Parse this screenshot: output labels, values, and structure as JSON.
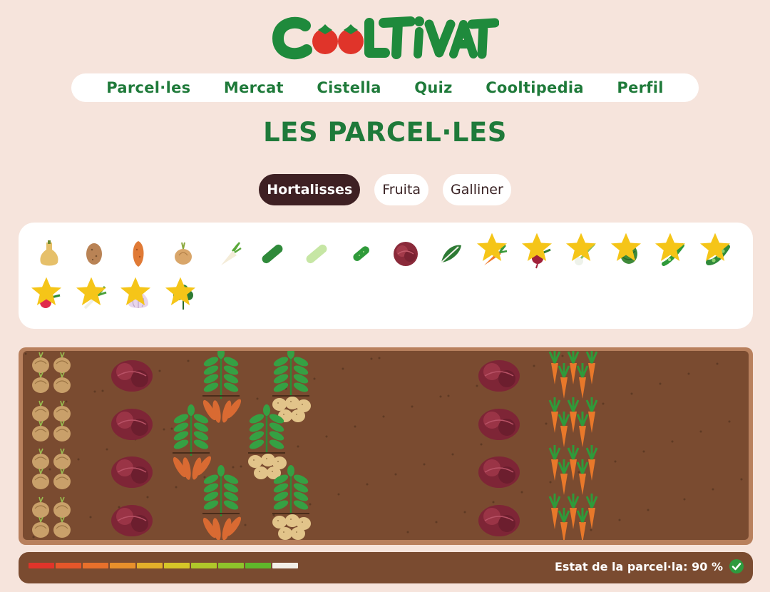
{
  "app": {
    "logo_text": "COOLTIVAT"
  },
  "nav": [
    {
      "label": "Parcel·les"
    },
    {
      "label": "Mercat"
    },
    {
      "label": "Cistella"
    },
    {
      "label": "Quiz"
    },
    {
      "label": "Cooltipedia"
    },
    {
      "label": "Perfil"
    }
  ],
  "page_title": "LES PARCEL·LES",
  "tabs": [
    {
      "label": "Hortalisses",
      "active": true
    },
    {
      "label": "Fruita",
      "active": false
    },
    {
      "label": "Galliner",
      "active": false
    }
  ],
  "seeds": [
    {
      "icon": "butternut-squash-icon",
      "starred": false
    },
    {
      "icon": "potato-icon",
      "starred": false
    },
    {
      "icon": "sweet-potato-icon",
      "starred": false
    },
    {
      "icon": "onion-icon",
      "starred": false
    },
    {
      "icon": "turnip-icon",
      "starred": false
    },
    {
      "icon": "cucumber-icon",
      "starred": false
    },
    {
      "icon": "zucchini-icon",
      "starred": false
    },
    {
      "icon": "gherkin-icon",
      "starred": false
    },
    {
      "icon": "red-lettuce-icon",
      "starred": false
    },
    {
      "icon": "chard-icon",
      "starred": false
    },
    {
      "icon": "carrot-icon",
      "starred": true
    },
    {
      "icon": "beetroot-icon",
      "starred": true
    },
    {
      "icon": "spring-onion-icon",
      "starred": true
    },
    {
      "icon": "artichoke-icon",
      "starred": true
    },
    {
      "icon": "green-bean-icon",
      "starred": true
    },
    {
      "icon": "pea-icon",
      "starred": true
    },
    {
      "icon": "radish-icon",
      "starred": true
    },
    {
      "icon": "leek-icon",
      "starred": true
    },
    {
      "icon": "garlic-icon",
      "starred": true
    },
    {
      "icon": "spinach-icon",
      "starred": true
    }
  ],
  "field": {
    "columns": [
      {
        "crop": "onion-icon"
      },
      {
        "crop": "red-lettuce-icon"
      },
      {
        "crop": "sweet-potato-icon"
      },
      {
        "crop": "potato-icon"
      },
      {
        "crop": "red-lettuce-icon"
      },
      {
        "crop": "carrot-icon"
      }
    ]
  },
  "status": {
    "label": "Estat de la parcel·la: 90 %",
    "value_percent": 90,
    "segments": 10,
    "segment_colors": [
      "#e0342a",
      "#e5562a",
      "#e8702b",
      "#e8902b",
      "#e3b02a",
      "#d6c628",
      "#b0c82a",
      "#8ec42b",
      "#5fb82b",
      "#f2efe8"
    ],
    "check_color": "#2e9a3e"
  }
}
